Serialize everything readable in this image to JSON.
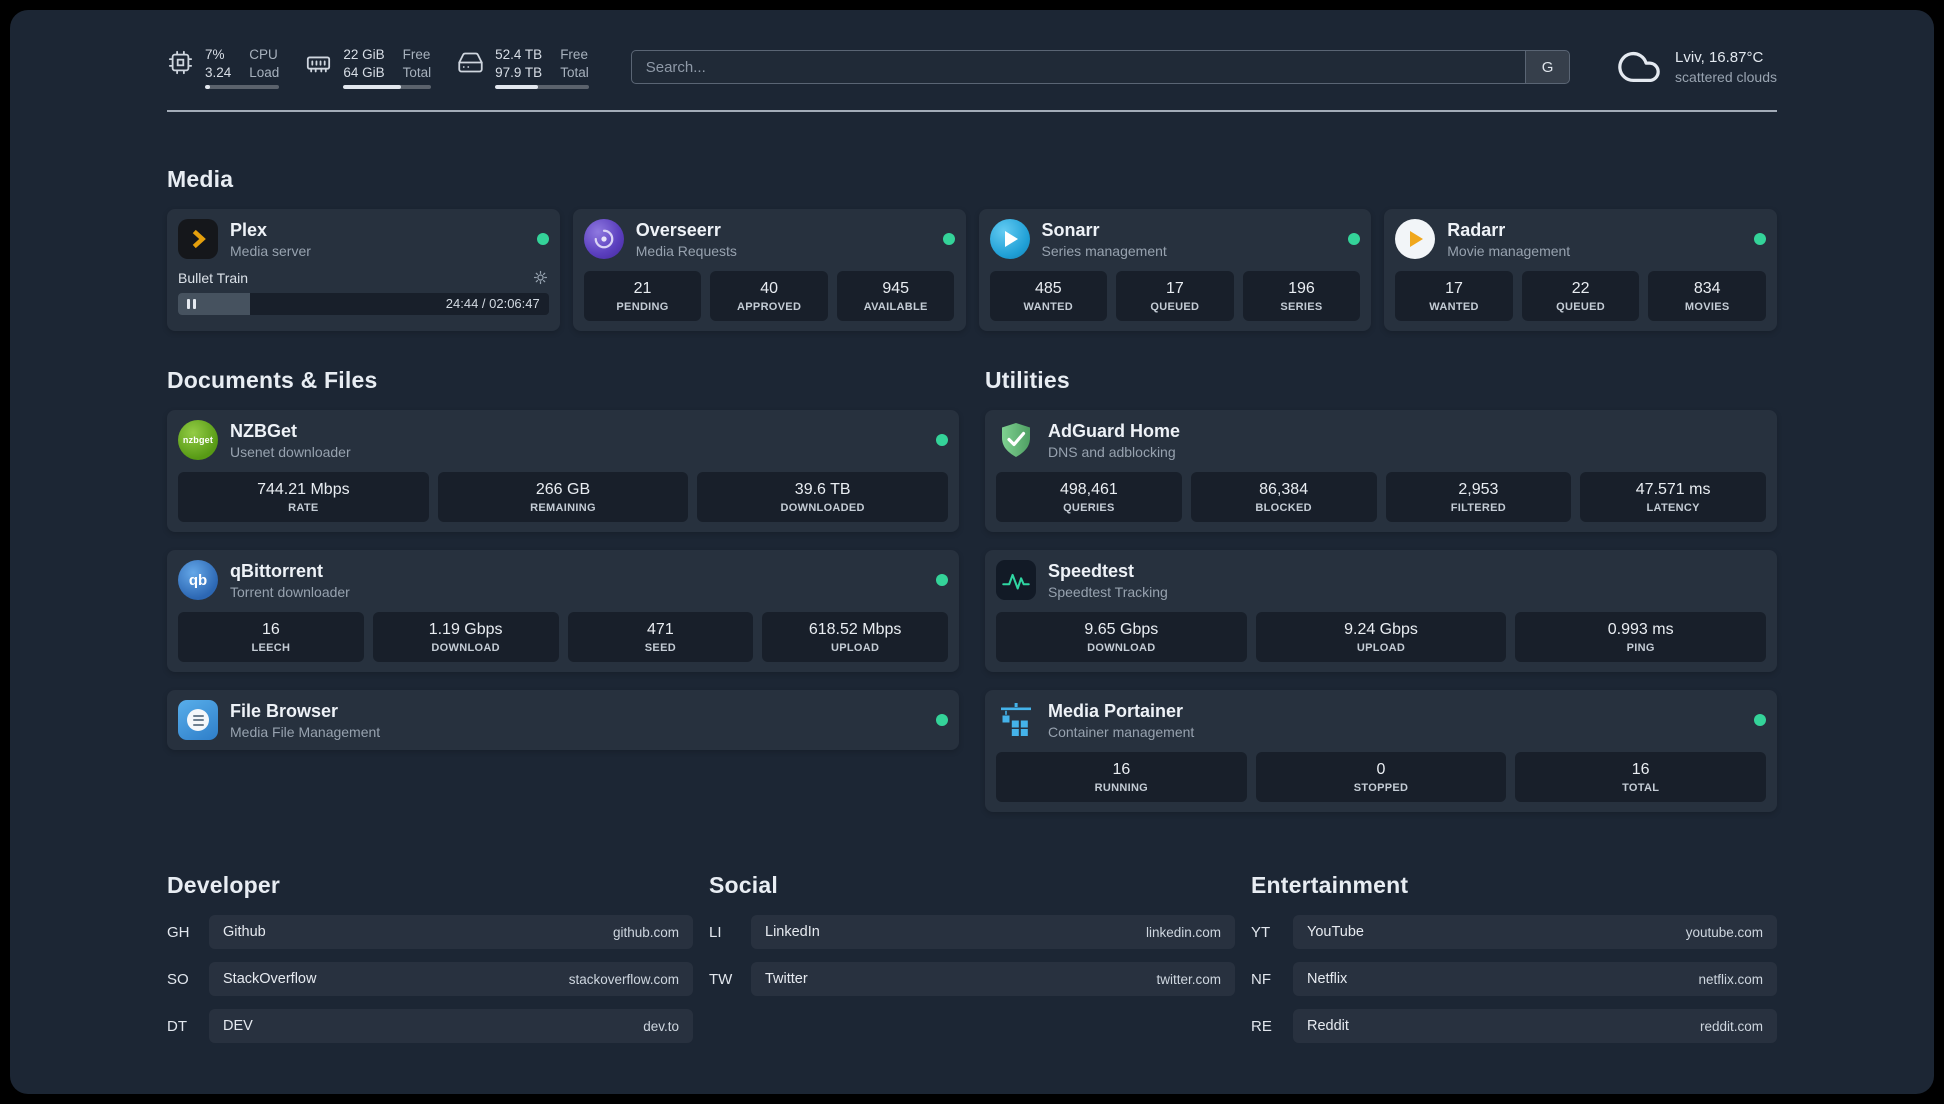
{
  "colors": {
    "status_online": "#34d399",
    "plex_amber": "#e5a00d",
    "adguard_green": "#5fae6f",
    "speedtest_green": "#2fd6a2",
    "portainer_blue": "#44b3ea"
  },
  "topbar": {
    "resources": [
      {
        "name": "cpu",
        "value1": "7%",
        "label1": "CPU",
        "value2": "3.24",
        "label2": "Load",
        "percent": 7
      },
      {
        "name": "memory",
        "value1": "22 GiB",
        "label1": "Free",
        "value2": "64 GiB",
        "label2": "Total",
        "percent": 66
      },
      {
        "name": "disk",
        "value1": "52.4 TB",
        "label1": "Free",
        "value2": "97.9 TB",
        "label2": "Total",
        "percent": 46
      }
    ],
    "search": {
      "placeholder": "Search...",
      "provider_label": "G"
    },
    "weather": {
      "location": "Lviv, 16.87°C",
      "condition": "scattered clouds"
    }
  },
  "media": {
    "title": "Media",
    "plex": {
      "name": "Plex",
      "desc": "Media server",
      "player_title": "Bullet Train",
      "player_time": "24:44 / 02:06:47",
      "progress": 19.5
    },
    "overseerr": {
      "name": "Overseerr",
      "desc": "Media Requests",
      "stats": [
        {
          "value": "21",
          "label": "PENDING"
        },
        {
          "value": "40",
          "label": "APPROVED"
        },
        {
          "value": "945",
          "label": "AVAILABLE"
        }
      ]
    },
    "sonarr": {
      "name": "Sonarr",
      "desc": "Series management",
      "stats": [
        {
          "value": "485",
          "label": "WANTED"
        },
        {
          "value": "17",
          "label": "QUEUED"
        },
        {
          "value": "196",
          "label": "SERIES"
        }
      ]
    },
    "radarr": {
      "name": "Radarr",
      "desc": "Movie management",
      "stats": [
        {
          "value": "17",
          "label": "WANTED"
        },
        {
          "value": "22",
          "label": "QUEUED"
        },
        {
          "value": "834",
          "label": "MOVIES"
        }
      ]
    }
  },
  "documents": {
    "title": "Documents & Files",
    "nzbget": {
      "name": "NZBGet",
      "desc": "Usenet downloader",
      "icon_text": "nzbget",
      "stats": [
        {
          "value": "744.21 Mbps",
          "label": "RATE"
        },
        {
          "value": "266 GB",
          "label": "REMAINING"
        },
        {
          "value": "39.6 TB",
          "label": "DOWNLOADED"
        }
      ]
    },
    "qbittorrent": {
      "name": "qBittorrent",
      "desc": "Torrent downloader",
      "icon_text": "qb",
      "stats": [
        {
          "value": "16",
          "label": "LEECH"
        },
        {
          "value": "1.19 Gbps",
          "label": "DOWNLOAD"
        },
        {
          "value": "471",
          "label": "SEED"
        },
        {
          "value": "618.52 Mbps",
          "label": "UPLOAD"
        }
      ]
    },
    "filebrowser": {
      "name": "File Browser",
      "desc": "Media File Management"
    }
  },
  "utilities": {
    "title": "Utilities",
    "adguard": {
      "name": "AdGuard Home",
      "desc": "DNS and adblocking",
      "stats": [
        {
          "value": "498,461",
          "label": "QUERIES"
        },
        {
          "value": "86,384",
          "label": "BLOCKED"
        },
        {
          "value": "2,953",
          "label": "FILTERED"
        },
        {
          "value": "47.571 ms",
          "label": "LATENCY"
        }
      ]
    },
    "speedtest": {
      "name": "Speedtest",
      "desc": "Speedtest Tracking",
      "stats": [
        {
          "value": "9.65 Gbps",
          "label": "DOWNLOAD"
        },
        {
          "value": "9.24 Gbps",
          "label": "UPLOAD"
        },
        {
          "value": "0.993 ms",
          "label": "PING"
        }
      ]
    },
    "portainer": {
      "name": "Media Portainer",
      "desc": "Container management",
      "stats": [
        {
          "value": "16",
          "label": "RUNNING"
        },
        {
          "value": "0",
          "label": "STOPPED"
        },
        {
          "value": "16",
          "label": "TOTAL"
        }
      ]
    }
  },
  "bookmarks": {
    "developer": {
      "title": "Developer",
      "items": [
        {
          "abbr": "GH",
          "name": "Github",
          "url": "github.com"
        },
        {
          "abbr": "SO",
          "name": "StackOverflow",
          "url": "stackoverflow.com"
        },
        {
          "abbr": "DT",
          "name": "DEV",
          "url": "dev.to"
        }
      ]
    },
    "social": {
      "title": "Social",
      "items": [
        {
          "abbr": "LI",
          "name": "LinkedIn",
          "url": "linkedin.com"
        },
        {
          "abbr": "TW",
          "name": "Twitter",
          "url": "twitter.com"
        }
      ]
    },
    "entertainment": {
      "title": "Entertainment",
      "items": [
        {
          "abbr": "YT",
          "name": "YouTube",
          "url": "youtube.com"
        },
        {
          "abbr": "NF",
          "name": "Netflix",
          "url": "netflix.com"
        },
        {
          "abbr": "RE",
          "name": "Reddit",
          "url": "reddit.com"
        }
      ]
    }
  }
}
